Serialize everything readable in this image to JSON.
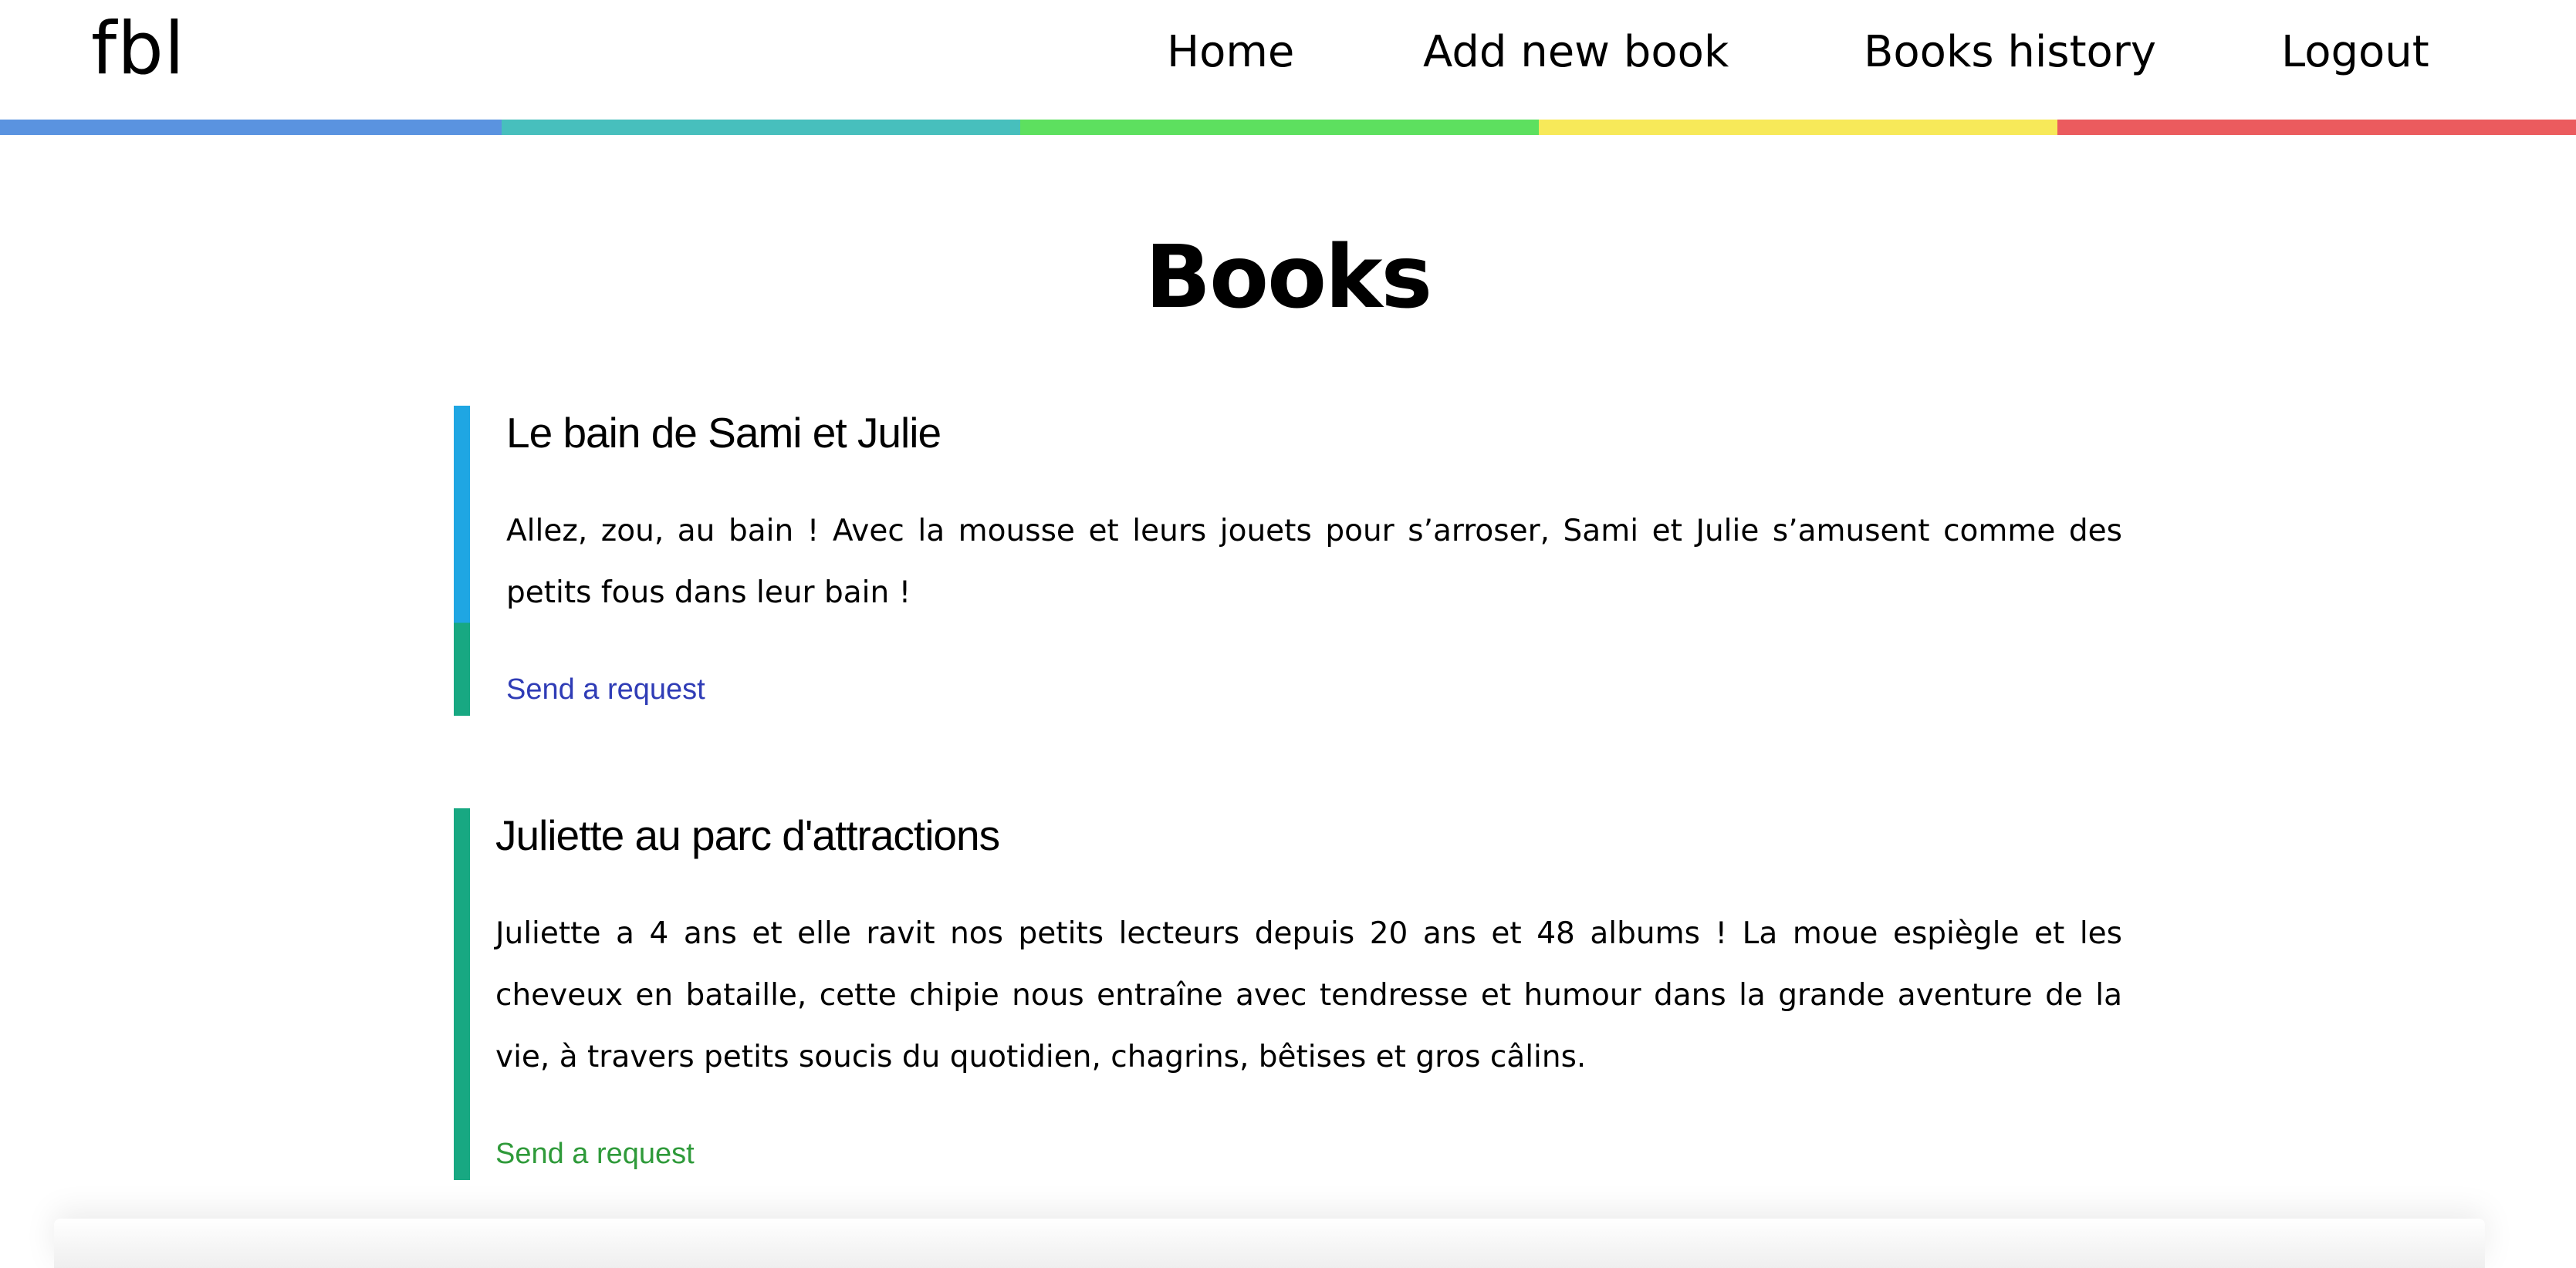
{
  "app": {
    "logo": "fbl"
  },
  "nav": {
    "items": [
      {
        "label": "Home"
      },
      {
        "label": "Add new book"
      },
      {
        "label": "Books history"
      },
      {
        "label": "Logout"
      }
    ]
  },
  "stripe_colors": [
    "#5a93e0",
    "#47bfbd",
    "#5de05f",
    "#f7e959",
    "#eb5b5e"
  ],
  "page": {
    "title": "Books"
  },
  "books": [
    {
      "title": "Le bain de Sami et Julie",
      "description": "Allez, zou, au bain ! Avec la mousse et leurs jouets pour s’arroser, Sami et Julie s’amusent comme des petits fous dans leur bain !",
      "link_label": "Send a request",
      "link_color": "#2f3cb6",
      "bar_colors": [
        "#1fa6e3",
        "#18a882"
      ]
    },
    {
      "title": "Juliette au parc d'attractions",
      "description": "Juliette a 4 ans et elle ravit nos petits lecteurs depuis 20 ans et 48 albums ! La moue espiègle et les cheveux en bataille, cette chipie nous entraîne avec tendresse et humour dans la grande aventure de la vie, à travers petits soucis du quotidien, chagrins, bêtises et gros câlins.",
      "link_label": "Send a request",
      "link_color": "#2f9a3a",
      "bar_colors": [
        "#18a882"
      ]
    }
  ]
}
